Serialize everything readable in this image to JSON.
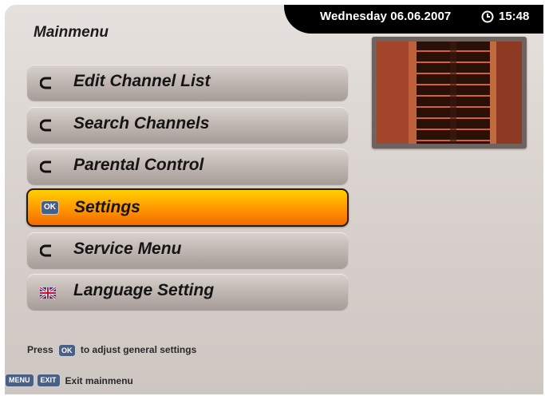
{
  "header": {
    "title": "Mainmenu",
    "date": "Wednesday 06.06.2007",
    "time": "15:48"
  },
  "menu": {
    "items": [
      {
        "label": "Edit Channel List",
        "icon": "arrow-icon"
      },
      {
        "label": "Search Channels",
        "icon": "arrow-icon"
      },
      {
        "label": "Parental Control",
        "icon": "arrow-icon"
      },
      {
        "label": "Settings",
        "icon": "ok-icon",
        "selected": true
      },
      {
        "label": "Service Menu",
        "icon": "arrow-icon"
      },
      {
        "label": "Language Setting",
        "icon": "uk-flag-icon"
      }
    ]
  },
  "hint": {
    "prefix": "Press",
    "key": "OK",
    "suffix": "to adjust general settings"
  },
  "footer": {
    "menu_key": "MENU",
    "exit_key": "EXIT",
    "exit_label": "Exit mainmenu"
  },
  "colors": {
    "highlight": "#ff9a00",
    "key_badge": "#4a5f86",
    "topbar": "#000000"
  }
}
